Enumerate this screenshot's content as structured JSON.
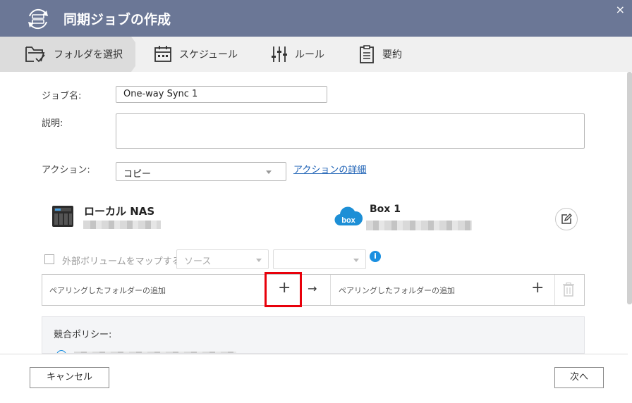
{
  "window": {
    "title": "同期ジョブの作成",
    "close_glyph": "×"
  },
  "steps": [
    {
      "label": "フォルダを選択",
      "icon": "folder-check-icon"
    },
    {
      "label": "スケジュール",
      "icon": "calendar-icon"
    },
    {
      "label": "ルール",
      "icon": "sliders-icon"
    },
    {
      "label": "要約",
      "icon": "clipboard-icon"
    }
  ],
  "form": {
    "job_name_label": "ジョブ名:",
    "job_name_value": "One-way Sync 1",
    "description_label": "説明:",
    "description_value": "",
    "action_label": "アクション:",
    "action_value": "コピー",
    "action_details_link": "アクションの詳細"
  },
  "local": {
    "name": "ローカル NAS",
    "icon": "nas-icon"
  },
  "remote": {
    "name": "Box 1",
    "icon": "box-cloud-icon",
    "logo_text": "box"
  },
  "mapping": {
    "checkbox_label": "外部ボリュームをマップする",
    "source_value": "ソース",
    "second_value": "",
    "info_glyph": "i"
  },
  "pairing": {
    "local_placeholder": "ペアリングしたフォルダーの追加",
    "remote_placeholder": "ペアリングしたフォルダーの追加",
    "plus_glyph": "+",
    "arrow_glyph": "→"
  },
  "policy": {
    "title": "競合ポリシー:"
  },
  "buttons": {
    "cancel": "キャンセル",
    "next": "次へ"
  },
  "colors": {
    "titlebar": "#6b7796",
    "highlight": "#e8000b",
    "link": "#1a5fb4"
  }
}
